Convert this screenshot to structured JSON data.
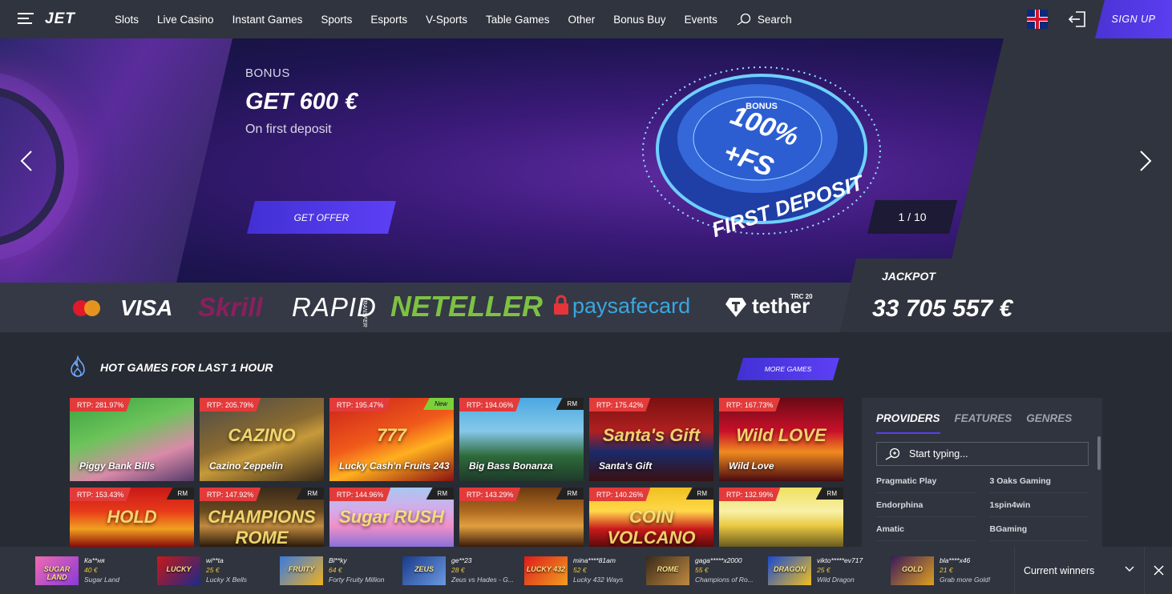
{
  "header": {
    "logo": "JET",
    "nav": [
      "Slots",
      "Live Casino",
      "Instant Games",
      "Sports",
      "Esports",
      "V-Sports",
      "Table Games",
      "Other",
      "Bonus Buy",
      "Events"
    ],
    "search_label": "Search",
    "signup_label": "SIGN UP"
  },
  "banner": {
    "eyebrow": "BONUS",
    "title": "GET 600 €",
    "subtitle": "On first deposit",
    "cta": "GET OFFER",
    "badge_top": "BONUS",
    "badge_main": "100%",
    "badge_fs": "+FS",
    "badge_bottom": "FIRST DEPOSIT",
    "pager": "1 / 10"
  },
  "payments": {
    "items": [
      "VISA",
      "Skrill",
      "RAPID",
      "TRANSFER",
      "NETELLER",
      "paysafecard",
      "tether",
      "TRC 20"
    ]
  },
  "jackpot": {
    "label": "JACKPOT",
    "value": "33 705 557 €"
  },
  "hot_games": {
    "title": "HOT GAMES FOR LAST 1 HOUR",
    "more": "MORE GAMES",
    "games": [
      {
        "rtp": "RTP: 281.97%",
        "name": "Piggy Bank Bills",
        "badge": "",
        "art": ""
      },
      {
        "rtp": "RTP: 205.79%",
        "name": "Cazino Zeppelin",
        "badge": "",
        "art": "CAZINO"
      },
      {
        "rtp": "RTP: 195.47%",
        "name": "Lucky Cash'n Fruits 243",
        "badge": "New",
        "art": "777"
      },
      {
        "rtp": "RTP: 194.06%",
        "name": "Big Bass Bonanza",
        "badge": "RM",
        "art": ""
      },
      {
        "rtp": "RTP: 175.42%",
        "name": "Santa's Gift",
        "badge": "",
        "art": "Santa's Gift"
      },
      {
        "rtp": "RTP: 167.73%",
        "name": "Wild Love",
        "badge": "",
        "art": "Wild LOVE"
      },
      {
        "rtp": "RTP: 153.43%",
        "name": "",
        "badge": "RM",
        "art": "HOLD"
      },
      {
        "rtp": "RTP: 147.92%",
        "name": "",
        "badge": "RM",
        "art": "CHAMPIONS ROME"
      },
      {
        "rtp": "RTP: 144.96%",
        "name": "",
        "badge": "RM",
        "art": "Sugar RUSH"
      },
      {
        "rtp": "RTP: 143.29%",
        "name": "",
        "badge": "RM",
        "art": ""
      },
      {
        "rtp": "RTP: 140.26%",
        "name": "",
        "badge": "RM",
        "art": "COIN VOLCANO"
      },
      {
        "rtp": "RTP: 132.99%",
        "name": "",
        "badge": "RM",
        "art": ""
      }
    ]
  },
  "providers": {
    "tabs": [
      "PROVIDERS",
      "FEATURES",
      "GENRES"
    ],
    "placeholder": "Start typing...",
    "list": [
      "Pragmatic Play",
      "3 Oaks Gaming",
      "Endorphina",
      "1spin4win",
      "Amatic",
      "BGaming"
    ]
  },
  "winners": {
    "label": "Current winners",
    "items": [
      {
        "user": "Ка**ня",
        "amount": "40 €",
        "game": "Sugar Land",
        "art": "SUGAR LAND"
      },
      {
        "user": "wi**ta",
        "amount": "25 €",
        "game": "Lucky X Bells",
        "art": "LUCKY"
      },
      {
        "user": "Bl**ky",
        "amount": "64 €",
        "game": "Forty Fruity Million",
        "art": "FRUITY"
      },
      {
        "user": "ge**23",
        "amount": "28 €",
        "game": "Zeus vs Hades - G...",
        "art": "ZEUS"
      },
      {
        "user": "mina****81am",
        "amount": "52 €",
        "game": "Lucky 432 Ways",
        "art": "LUCKY 432"
      },
      {
        "user": "gaga*****x2000",
        "amount": "55 €",
        "game": "Champions of Ro...",
        "art": "ROME"
      },
      {
        "user": "vikto*****ev717",
        "amount": "25 €",
        "game": "Wild Dragon",
        "art": "DRAGON"
      },
      {
        "user": "bla****x46",
        "amount": "21 €",
        "game": "Grab more Gold!",
        "art": "GOLD"
      }
    ]
  },
  "colors": {
    "accent": "#5b3ef0",
    "rtp": "#e33a3a",
    "gold": "#f3c73a",
    "panel": "#30343e",
    "bg": "#272b34"
  }
}
